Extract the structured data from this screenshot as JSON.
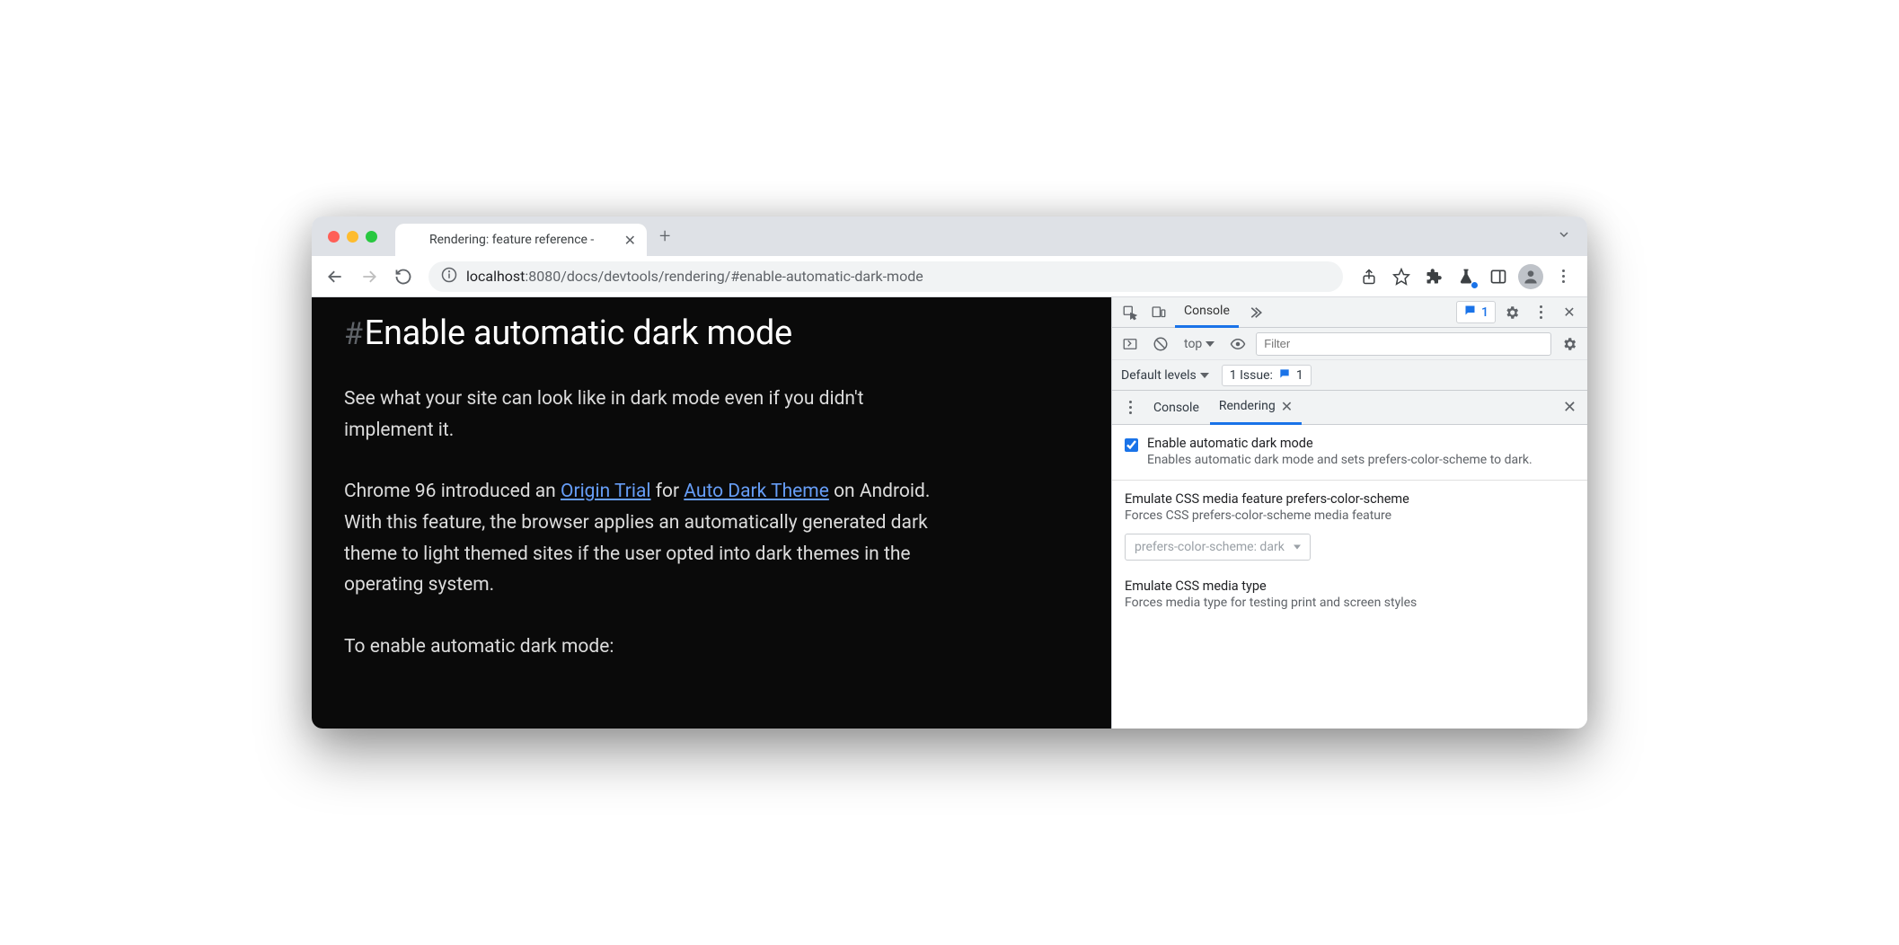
{
  "chrome": {
    "tab_title": "Rendering: feature reference -",
    "url_host": "localhost",
    "url_port": ":8080",
    "url_path": "/docs/devtools/rendering/#enable-automatic-dark-mode"
  },
  "page": {
    "hash": "#",
    "heading": "Enable automatic dark mode",
    "p1": "See what your site can look like in dark mode even if you didn't implement it.",
    "p2_a": "Chrome 96 introduced an ",
    "link1": "Origin Trial",
    "p2_b": " for ",
    "link2": "Auto Dark Theme",
    "p2_c": " on Android. With this feature, the browser applies an automatically generated dark theme to light themed sites if the user opted into dark themes in the operating system.",
    "p3": "To enable automatic dark mode:"
  },
  "devtools": {
    "tabs": {
      "console": "Console"
    },
    "issue_count": "1",
    "console_bar": {
      "context": "top",
      "filter_placeholder": "Filter",
      "levels": "Default levels",
      "issue_label": "1 Issue:",
      "issue_n": "1"
    },
    "drawer": {
      "console": "Console",
      "rendering": "Rendering"
    },
    "settings": {
      "darkmode_title": "Enable automatic dark mode",
      "darkmode_desc": "Enables automatic dark mode and sets prefers-color-scheme to dark.",
      "pcs_title": "Emulate CSS media feature prefers-color-scheme",
      "pcs_desc": "Forces CSS prefers-color-scheme media feature",
      "pcs_value": "prefers-color-scheme: dark",
      "mediatype_title": "Emulate CSS media type",
      "mediatype_desc": "Forces media type for testing print and screen styles"
    }
  }
}
